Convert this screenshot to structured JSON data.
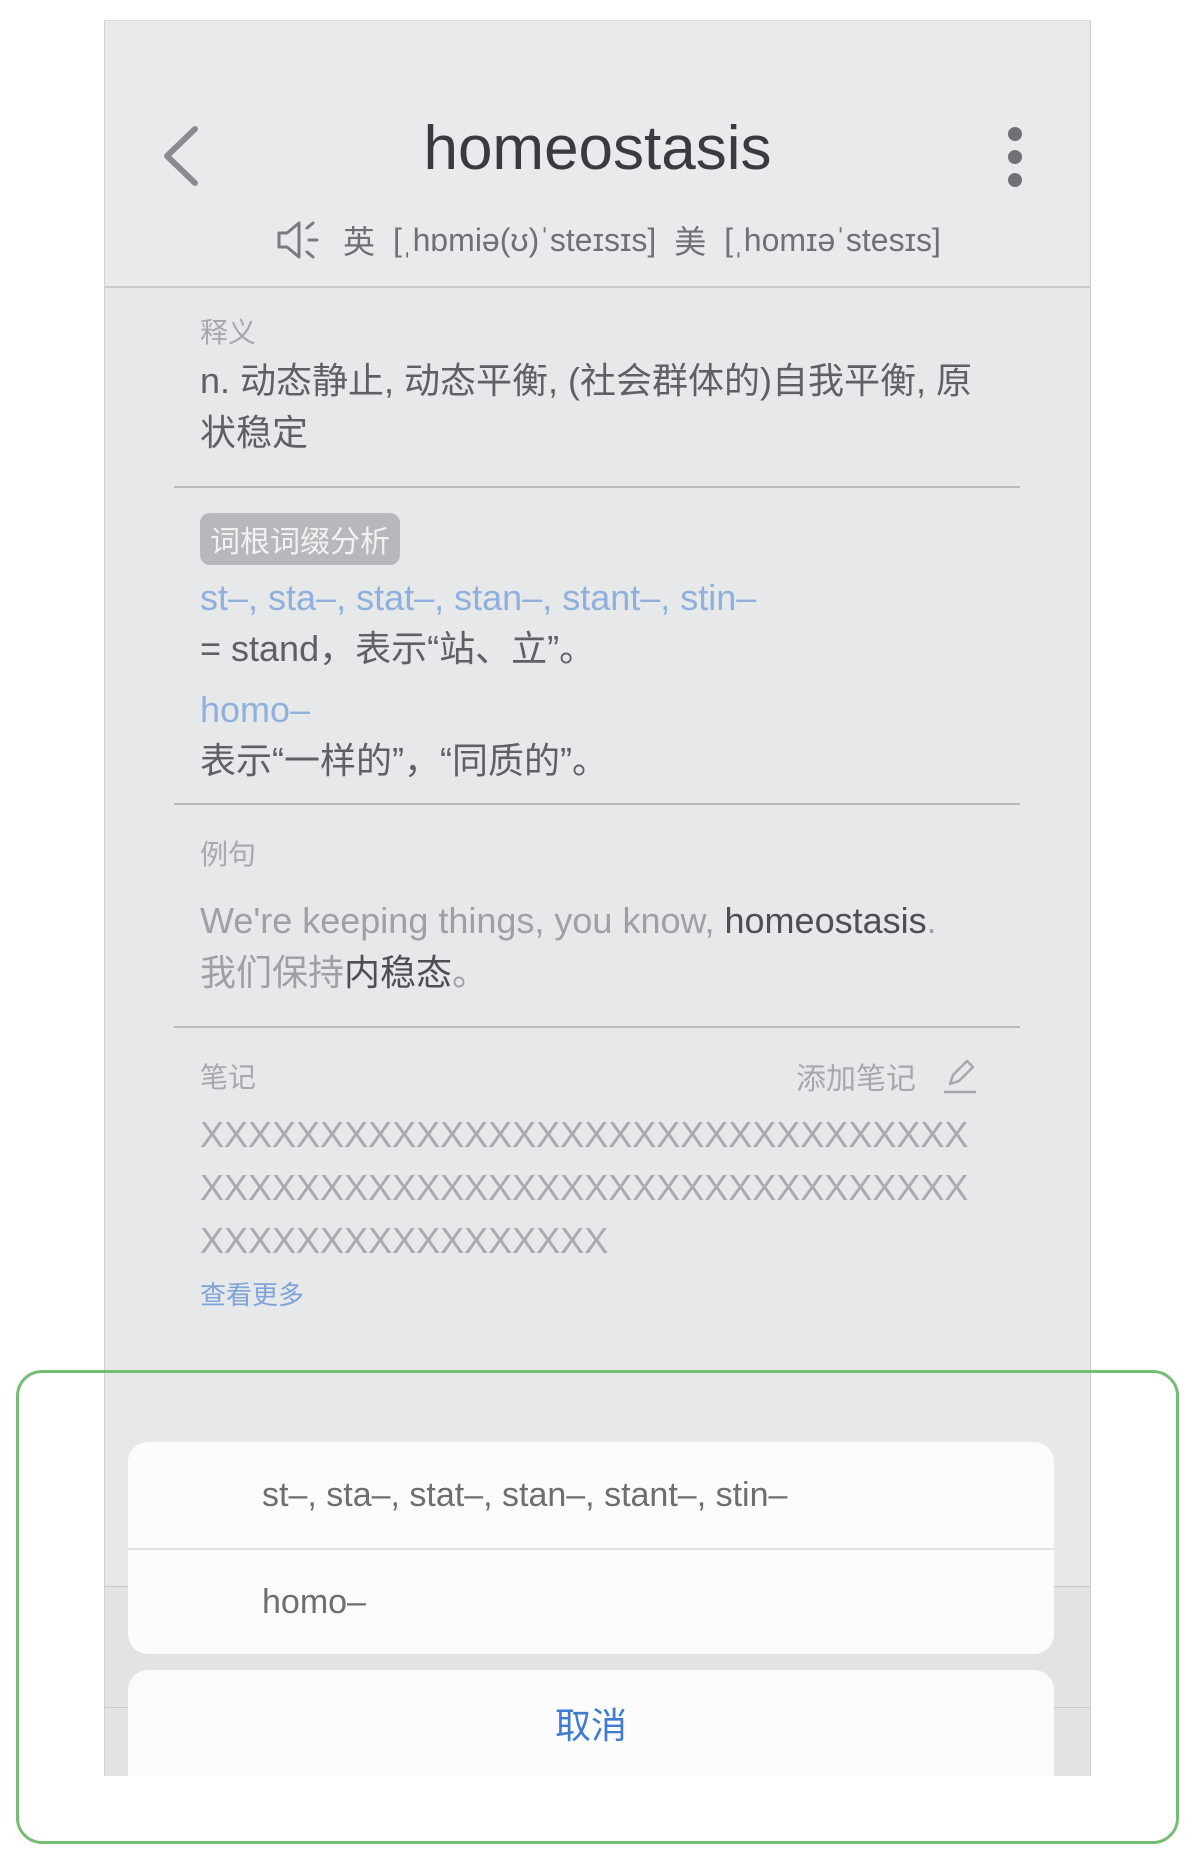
{
  "header": {
    "word": "homeostasis",
    "pron_uk_label": "英",
    "pron_uk": "[ˌhɒmiə(ʊ)ˈsteɪsɪs]",
    "pron_us_label": "美",
    "pron_us": "[ˌhomɪəˈstesɪs]"
  },
  "definition": {
    "label": "释义",
    "text": "n. 动态静止, 动态平衡, (社会群体的)自我平衡, 原状稳定"
  },
  "roots": {
    "badge": "词根词缀分析",
    "items": [
      {
        "root": "st–, sta–, stat–, stan–, stant–, stin–",
        "meaning": "= stand，表示“站、立”。"
      },
      {
        "root": "homo–",
        "meaning": "表示“一样的”，“同质的”。"
      }
    ]
  },
  "example": {
    "label": "例句",
    "en_before": "We're keeping things, you know, ",
    "en_highlight": "homeostasis",
    "en_after": ".",
    "cn_before": "我们保持",
    "cn_highlight": "内稳态",
    "cn_after": "。"
  },
  "notes": {
    "label": "笔记",
    "add_label": "添加笔记",
    "text": "XXXXXXXXXXXXXXXXXXXXXXXXXXXXXXXXXXXXXXXXXXXXXXXXXXXXXXXXXXXXXXXXXXXXXXXXXXXXXXXXX",
    "more": "查看更多"
  },
  "action_sheet": {
    "options": [
      "st–, sta–, stat–, stan–, stant–, stin–",
      "homo–"
    ],
    "cancel": "取消"
  },
  "colors": {
    "link": "#8fb0dc",
    "cancel": "#3f7bd2",
    "highlight_border": "#74bd75"
  }
}
